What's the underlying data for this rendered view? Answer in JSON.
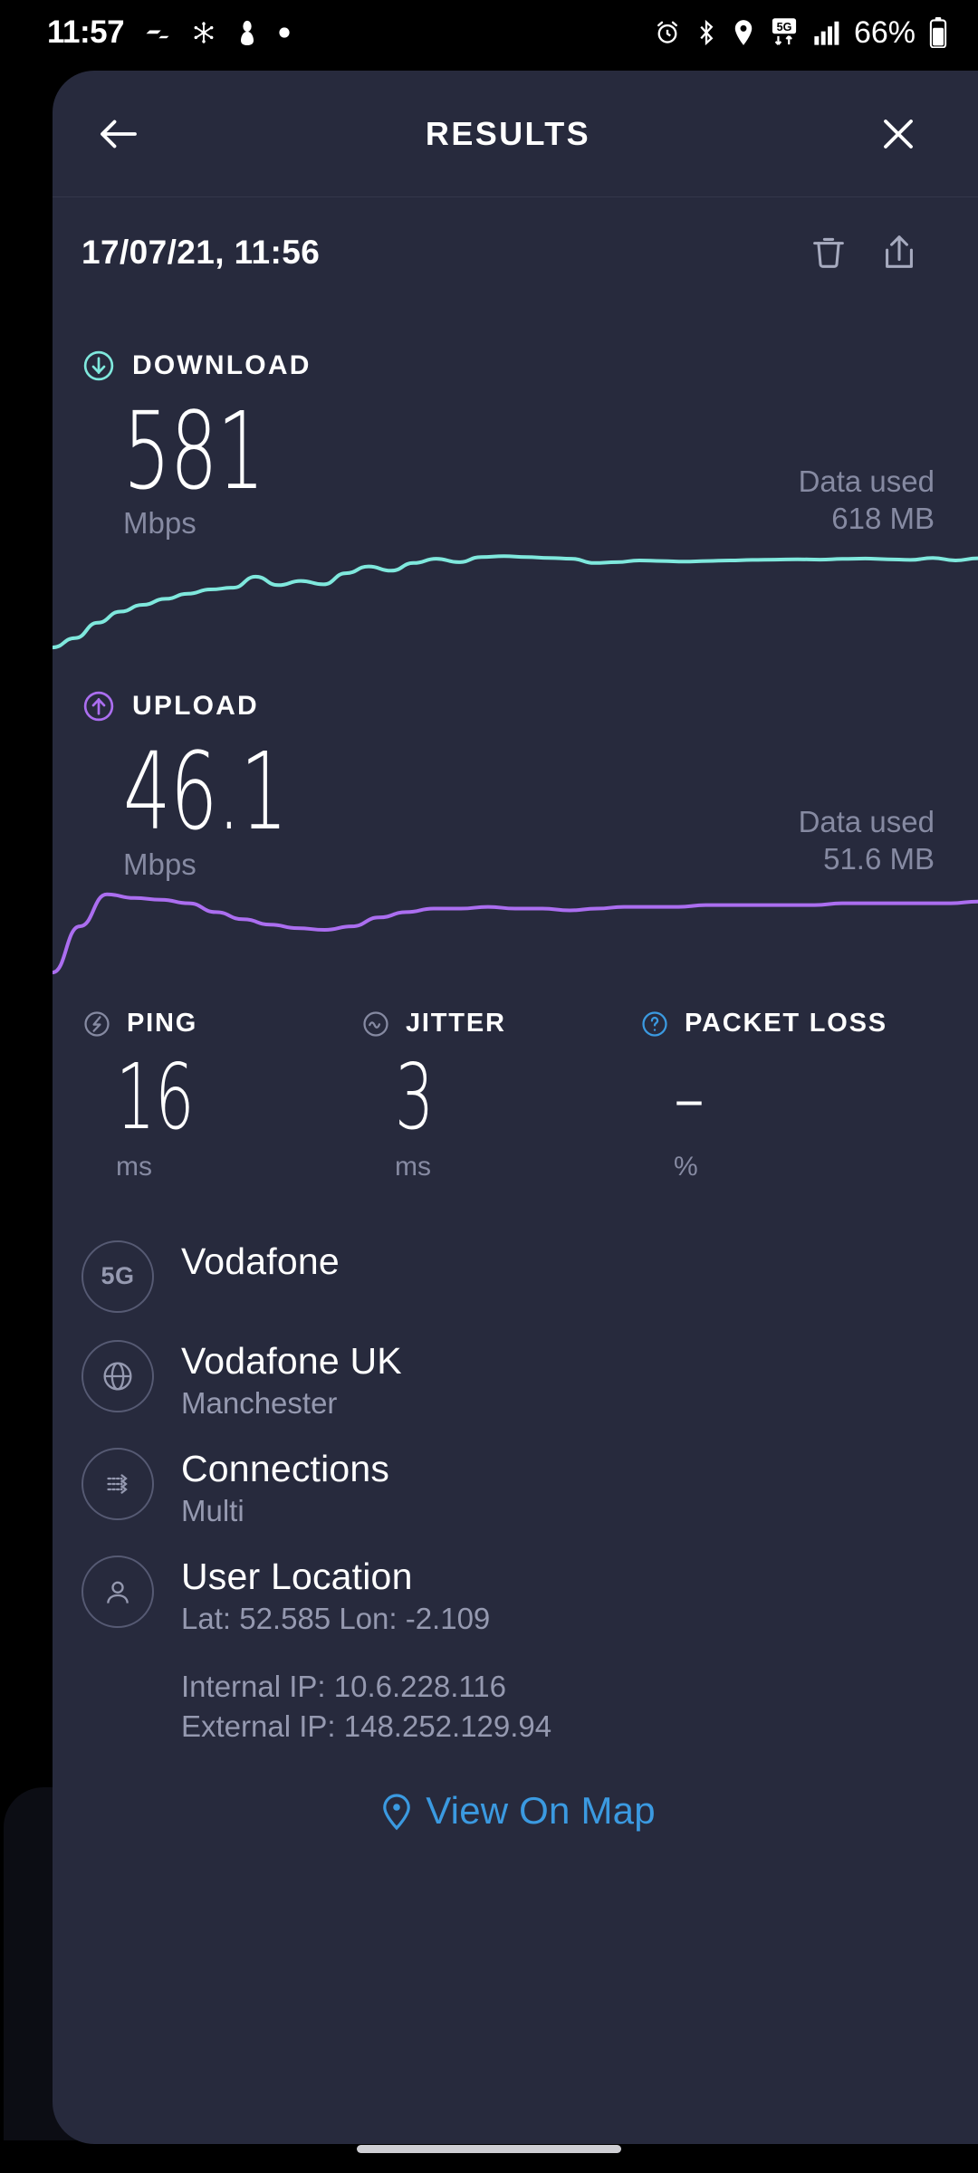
{
  "status_bar": {
    "clock": "11:57",
    "battery_percent": "66%",
    "left_icons": [
      "f1-icon",
      "snowflake-icon",
      "incognito-icon",
      "dot-icon"
    ],
    "right_icons": [
      "alarm-icon",
      "bluetooth-icon",
      "location-icon",
      "5g-network-icon",
      "signal-bars-icon",
      "battery-icon"
    ]
  },
  "app_bar": {
    "title": "RESULTS",
    "back_icon": "arrow-left-icon",
    "close_icon": "close-icon"
  },
  "result_header": {
    "timestamp": "17/07/21, 11:56",
    "delete_icon": "trash-icon",
    "share_icon": "share-icon"
  },
  "download": {
    "label": "DOWNLOAD",
    "icon": "circle-arrow-down-icon",
    "value": "581",
    "unit": "Mbps",
    "data_used_label": "Data used",
    "data_used_value": "618 MB",
    "color": "#7fe8dd"
  },
  "upload": {
    "label": "UPLOAD",
    "icon": "circle-arrow-up-icon",
    "value": "46.1",
    "unit": "Mbps",
    "data_used_label": "Data used",
    "data_used_value": "51.6 MB",
    "color": "#ab6ef0"
  },
  "metrics": [
    {
      "label": "PING",
      "icon": "ping-bolt-icon",
      "value": "16",
      "unit": "ms",
      "icon_color": "#868aa2"
    },
    {
      "label": "JITTER",
      "icon": "jitter-wave-icon",
      "value": "3",
      "unit": "ms",
      "icon_color": "#868aa2"
    },
    {
      "label": "PACKET LOSS",
      "icon": "question-mark-icon",
      "value": "–",
      "unit": "%",
      "icon_color": "#3b9ae1"
    }
  ],
  "info_rows": [
    {
      "icon": "5g-badge-icon",
      "icon_text": "5G",
      "title": "Vodafone",
      "subtitle": ""
    },
    {
      "icon": "globe-icon",
      "icon_text": "",
      "title": "Vodafone UK",
      "subtitle": "Manchester"
    },
    {
      "icon": "connections-arrows-icon",
      "icon_text": "",
      "title": "Connections",
      "subtitle": "Multi"
    },
    {
      "icon": "user-avatar-icon",
      "icon_text": "",
      "title": "User Location",
      "subtitle": "Lat: 52.585 Lon: -2.109"
    }
  ],
  "ip_info": {
    "internal": "Internal IP: 10.6.228.116",
    "external": "External IP: 148.252.129.94"
  },
  "map_link": {
    "label": "View On Map",
    "icon": "map-pin-icon",
    "color": "#3b9ae1"
  },
  "chart_data": [
    {
      "type": "line",
      "title": "Download throughput over test duration",
      "ylabel": "Mbps",
      "series": [
        {
          "name": "Download",
          "color": "#7fe8dd",
          "values": [
            5,
            60,
            150,
            215,
            255,
            290,
            320,
            345,
            355,
            420,
            370,
            395,
            375,
            440,
            480,
            455,
            500,
            525,
            505,
            535,
            540,
            535,
            530,
            525,
            500,
            505,
            515,
            512,
            508,
            512,
            515,
            518,
            520,
            522,
            520,
            524,
            526,
            522,
            518,
            530,
            515,
            528
          ]
        }
      ],
      "ylim": [
        0,
        600
      ],
      "grid": false,
      "legend": "none"
    },
    {
      "type": "line",
      "title": "Upload throughput over test duration",
      "ylabel": "Mbps",
      "series": [
        {
          "name": "Upload",
          "color": "#ab6ef0",
          "values": [
            2,
            28,
            46,
            44,
            43,
            41,
            36,
            32,
            29,
            27,
            26,
            28,
            33,
            36,
            38,
            38,
            39,
            38,
            38,
            37,
            38,
            39,
            39,
            39,
            40,
            40,
            40,
            40,
            40,
            41,
            41,
            41,
            41,
            41,
            42
          ]
        }
      ],
      "ylim": [
        0,
        50
      ],
      "grid": false,
      "legend": "none"
    }
  ]
}
